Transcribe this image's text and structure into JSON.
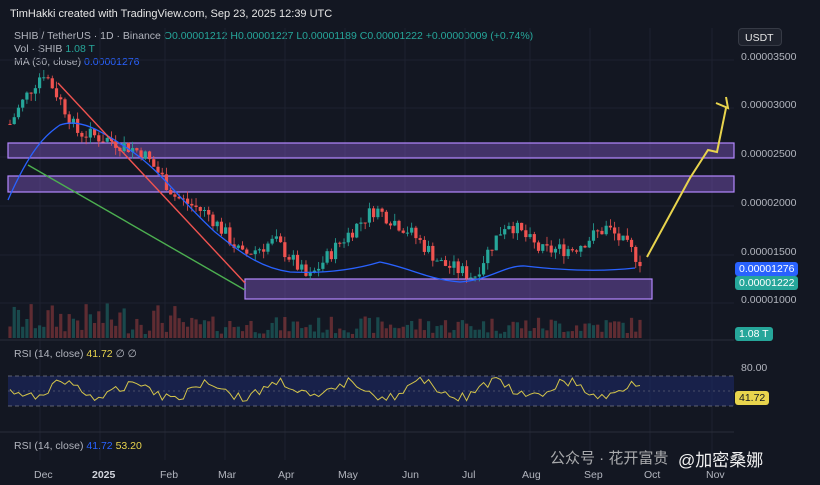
{
  "header": {
    "created_by": "TimHakki created with TradingView.com, Sep 23, 2025 12:39 UTC"
  },
  "legend": {
    "symbol": "SHIB / TetherUS · 1D · Binance",
    "ohlc": "O0.00001212 H0.00001227 L0.00001189 C0.00001222 +0.00000009 (+0.74%)",
    "vol_label": "Vol · SHIB",
    "vol_value": "1.08 T",
    "ma_label": "MA (30, close)",
    "ma_value": "0.00001276"
  },
  "currency_button": "USDT",
  "price_tags": {
    "ma": "0.00001276",
    "close": "0.00001222",
    "volume": "1.08 T",
    "rsi": "41.72"
  },
  "rsi": {
    "label1": "RSI (14, close)",
    "value1": "41.72",
    "label2": "RSI (14, close)",
    "value2a": "41.72",
    "value2b": "53.20",
    "levels": [
      "80.00"
    ]
  },
  "watermark": {
    "wechat": "公众号 · 花开富贵",
    "brand": "@加密桑娜"
  },
  "colors": {
    "up": "#26a69a",
    "down": "#ef5350",
    "ma": "#2962ff",
    "zone": "#7e57c2",
    "arrow": "#e8d44d",
    "wedge_top": "#ef5350",
    "wedge_bottom": "#4caf50"
  },
  "chart_data": {
    "type": "candlestick",
    "y_axis": {
      "scale": "log",
      "ticks": [
        "0.00003500",
        "0.00003000",
        "0.00002500",
        "0.00002000",
        "0.00001500",
        "0.00001000"
      ]
    },
    "x_axis": {
      "ticks": [
        "Dec",
        "2025",
        "Feb",
        "Mar",
        "Apr",
        "May",
        "Jun",
        "Jul",
        "Aug",
        "Sep",
        "Oct",
        "Nov"
      ]
    },
    "price_points": [
      {
        "t": "Nov 25",
        "v": 2.5e-05
      },
      {
        "t": "Dec 8",
        "v": 3.3e-05
      },
      {
        "t": "Dec 20",
        "v": 2.4e-05
      },
      {
        "t": "Jan 6",
        "v": 2.3e-05
      },
      {
        "t": "Jan 20",
        "v": 2.15e-05
      },
      {
        "t": "Feb 3",
        "v": 1.7e-05
      },
      {
        "t": "Feb 20",
        "v": 1.55e-05
      },
      {
        "t": "Mar 10",
        "v": 1.25e-05
      },
      {
        "t": "Mar 25",
        "v": 1.35e-05
      },
      {
        "t": "Apr 7",
        "v": 1.1e-05
      },
      {
        "t": "Apr 25",
        "v": 1.35e-05
      },
      {
        "t": "May 10",
        "v": 1.6e-05
      },
      {
        "t": "May 25",
        "v": 1.43e-05
      },
      {
        "t": "Jun 15",
        "v": 1.2e-05
      },
      {
        "t": "Jul 1",
        "v": 1.12e-05
      },
      {
        "t": "Jul 20",
        "v": 1.5e-05
      },
      {
        "t": "Aug 5",
        "v": 1.28e-05
      },
      {
        "t": "Aug 25",
        "v": 1.3e-05
      },
      {
        "t": "Sep 12",
        "v": 1.45e-05
      },
      {
        "t": "Sep 23",
        "v": 1.22e-05
      }
    ],
    "zones": [
      {
        "name": "resistance-1",
        "low": 2.49e-05,
        "high": 2.63e-05
      },
      {
        "name": "resistance-2",
        "low": 2.09e-05,
        "high": 2.22e-05
      },
      {
        "name": "support",
        "low": 1.03e-05,
        "high": 1.2e-05
      }
    ],
    "projection": [
      1.25e-05,
      2.1e-05,
      2.55e-05,
      3e-05
    ],
    "ma_last": 1.276e-05,
    "close_last": 1.222e-05,
    "rsi_last": 41.72
  }
}
